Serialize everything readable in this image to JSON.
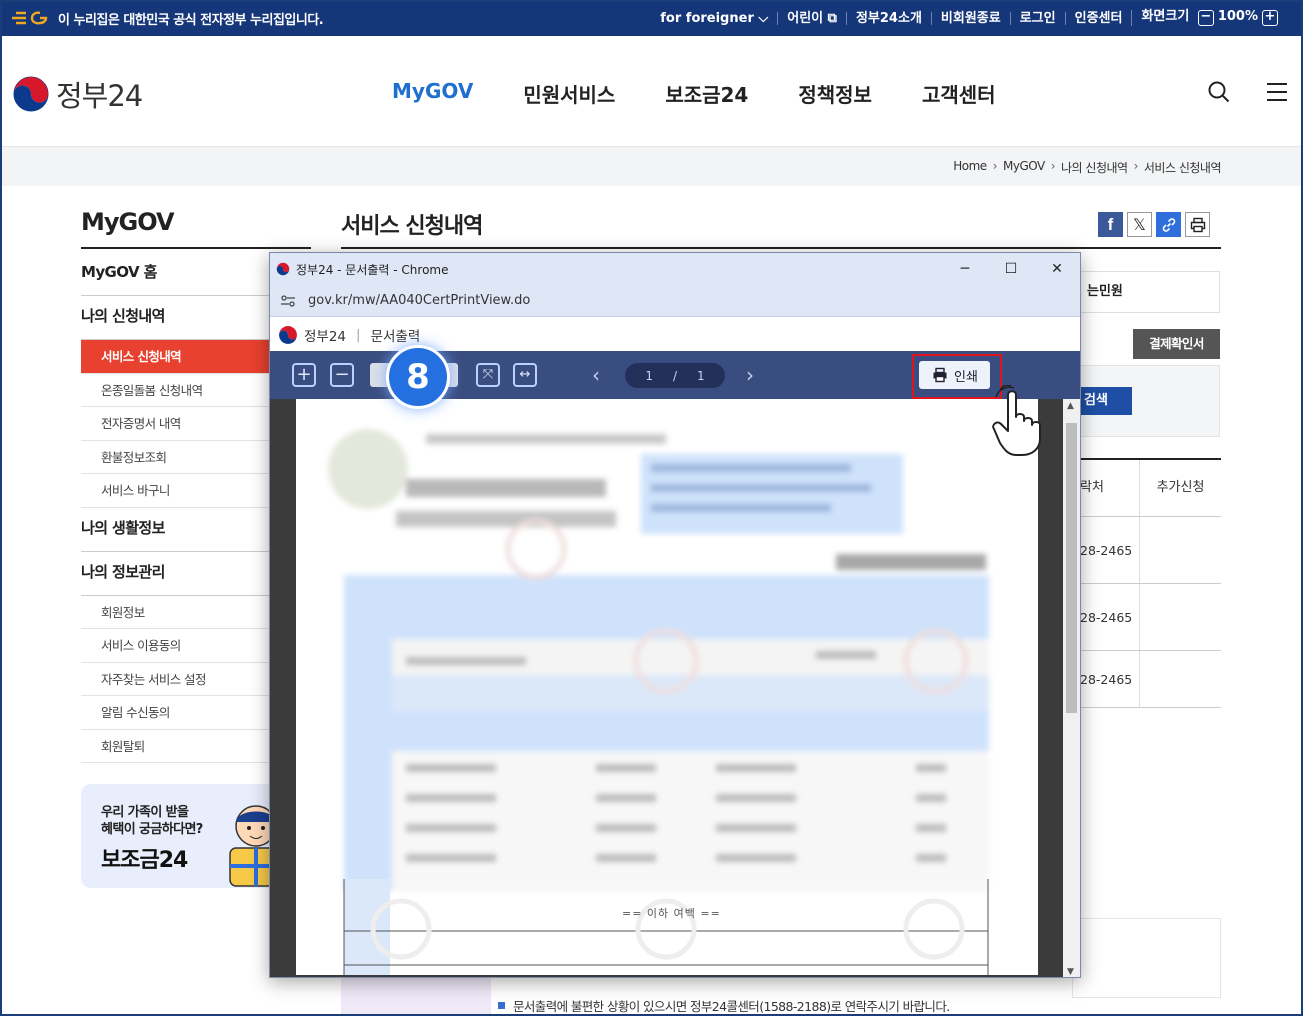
{
  "topbar": {
    "notice": "이 누리집은 대한민국 공식 전자정부 누리집입니다.",
    "links": [
      "for foreigner",
      "어린이",
      "정부24소개",
      "비회원종료",
      "로그인",
      "인증센터",
      "화면크기"
    ],
    "zoom_minus": "−",
    "zoom_value": "100%",
    "zoom_plus": "+"
  },
  "header": {
    "logo_text": "정부24",
    "nav": [
      "MyGOV",
      "민원서비스",
      "보조금24",
      "정책정보",
      "고객센터"
    ]
  },
  "breadcrumb": [
    "Home",
    "MyGOV",
    "나의 신청내역",
    "서비스 신청내역"
  ],
  "sidebar": {
    "title": "MyGOV",
    "home": "MyGOV 홈",
    "group1": "나의 신청내역",
    "group1_items": [
      "서비스 신청내역",
      "온종일돌봄 신청내역",
      "전자증명서 내역",
      "환불정보조회",
      "서비스 바구니"
    ],
    "group2": "나의 생활정보",
    "group3": "나의 정보관리",
    "group3_items": [
      "회원정보",
      "서비스 이용동의",
      "자주찾는 서비스 설정",
      "알림 수신동의",
      "회원탈퇴"
    ],
    "banner_line1": "우리 가족이 받을",
    "banner_line2": "혜택이 궁금하다면?",
    "banner_title": "보조금24"
  },
  "main": {
    "title": "서비스 신청내역",
    "box1_text": "는민원",
    "confirm_button": "결제확인서",
    "search_button": "검색",
    "table_headers": [
      "락처",
      "추가신청"
    ],
    "rows": [
      "28-2465",
      "28-2465",
      "28-2465"
    ],
    "bottom_note": "문서출력에 불편한 상황이 있으시면 정부24콜센터(1588-2188)로 연락주시기 바랍니다."
  },
  "popup": {
    "window_title": "정부24 - 문서출력 - Chrome",
    "address": "gov.kr/mw/AA040CertPrintView.do",
    "brand": "정부24",
    "brand_sub": "문서출력",
    "page_current": "1",
    "page_sep": "/",
    "page_total": "1",
    "print_label": "인쇄",
    "end_text": "== 이하 여백 =="
  },
  "step_badge": "8",
  "colors": {
    "navy": "#16367a",
    "accent_blue": "#1e6fd0",
    "active_red": "#e8412f",
    "highlight_red": "#e0141e",
    "toolbar": "#3a4d80"
  }
}
